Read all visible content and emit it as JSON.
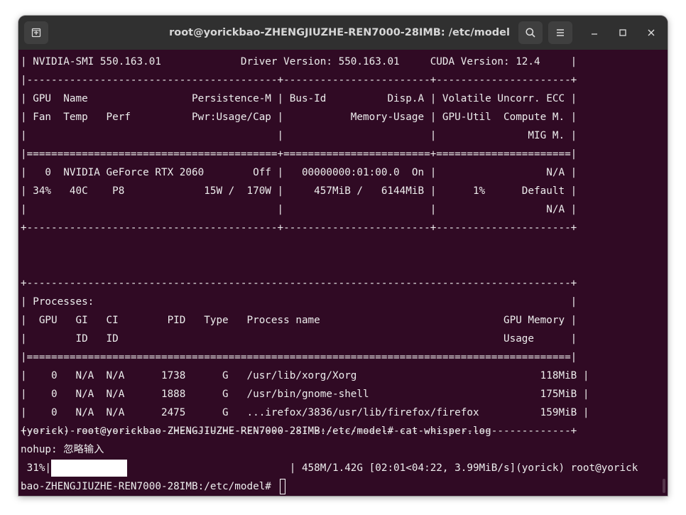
{
  "window": {
    "title": "root@yorickbao-ZHENGJIUZHE-REN7000-28IMB: /etc/model",
    "icons": {
      "new_tab": "new-tab-icon",
      "search": "search-icon",
      "menu": "hamburger-menu-icon",
      "minimize": "minimize-icon",
      "maximize": "maximize-icon",
      "close": "close-icon"
    }
  },
  "colors": {
    "terminal_bg": "#300a24",
    "titlebar_bg": "#303030",
    "text": "#ededed"
  },
  "terminal": {
    "lines": [
      "| NVIDIA-SMI 550.163.01             Driver Version: 550.163.01     CUDA Version: 12.4     |",
      "|-----------------------------------------+------------------------+----------------------+",
      "| GPU  Name                 Persistence-M | Bus-Id          Disp.A | Volatile Uncorr. ECC |",
      "| Fan  Temp   Perf          Pwr:Usage/Cap |           Memory-Usage | GPU-Util  Compute M. |",
      "|                                         |                        |               MIG M. |",
      "|=========================================+========================+======================|",
      "|   0  NVIDIA GeForce RTX 2060        Off |   00000000:01:00.0  On |                  N/A |",
      "| 34%   40C    P8             15W /  170W |     457MiB /   6144MiB |      1%      Default |",
      "|                                         |                        |                  N/A |",
      "+-----------------------------------------+------------------------+----------------------+",
      "",
      "",
      "+-----------------------------------------------------------------------------------------+",
      "| Processes:                                                                              |",
      "|  GPU   GI   CI        PID   Type   Process name                              GPU Memory |",
      "|        ID   ID                                                               Usage      |",
      "|=========================================================================================|",
      "|    0   N/A  N/A      1738      G   /usr/lib/xorg/Xorg                              118MiB |",
      "|    0   N/A  N/A      1888      G   /usr/bin/gnome-shell                            175MiB |",
      "|    0   N/A  N/A      2475      G   ...irefox/3836/usr/lib/firefox/firefox          159MiB |",
      "+-----------------------------------------------------------------------------------------+",
      "(yorick) root@yorickbao-ZHENGJIUZHE-REN7000-28IMB:/etc/model# cat whisper.log",
      "nohup: 忽略输入",
      " 31%|                                       | 458M/1.42G [02:01<04:22, 3.99MiB/s](yorick) root@yorick",
      "bao-ZHENGJIUZHE-REN7000-28IMB:/etc/model# "
    ],
    "progress_fraction": 0.31
  }
}
